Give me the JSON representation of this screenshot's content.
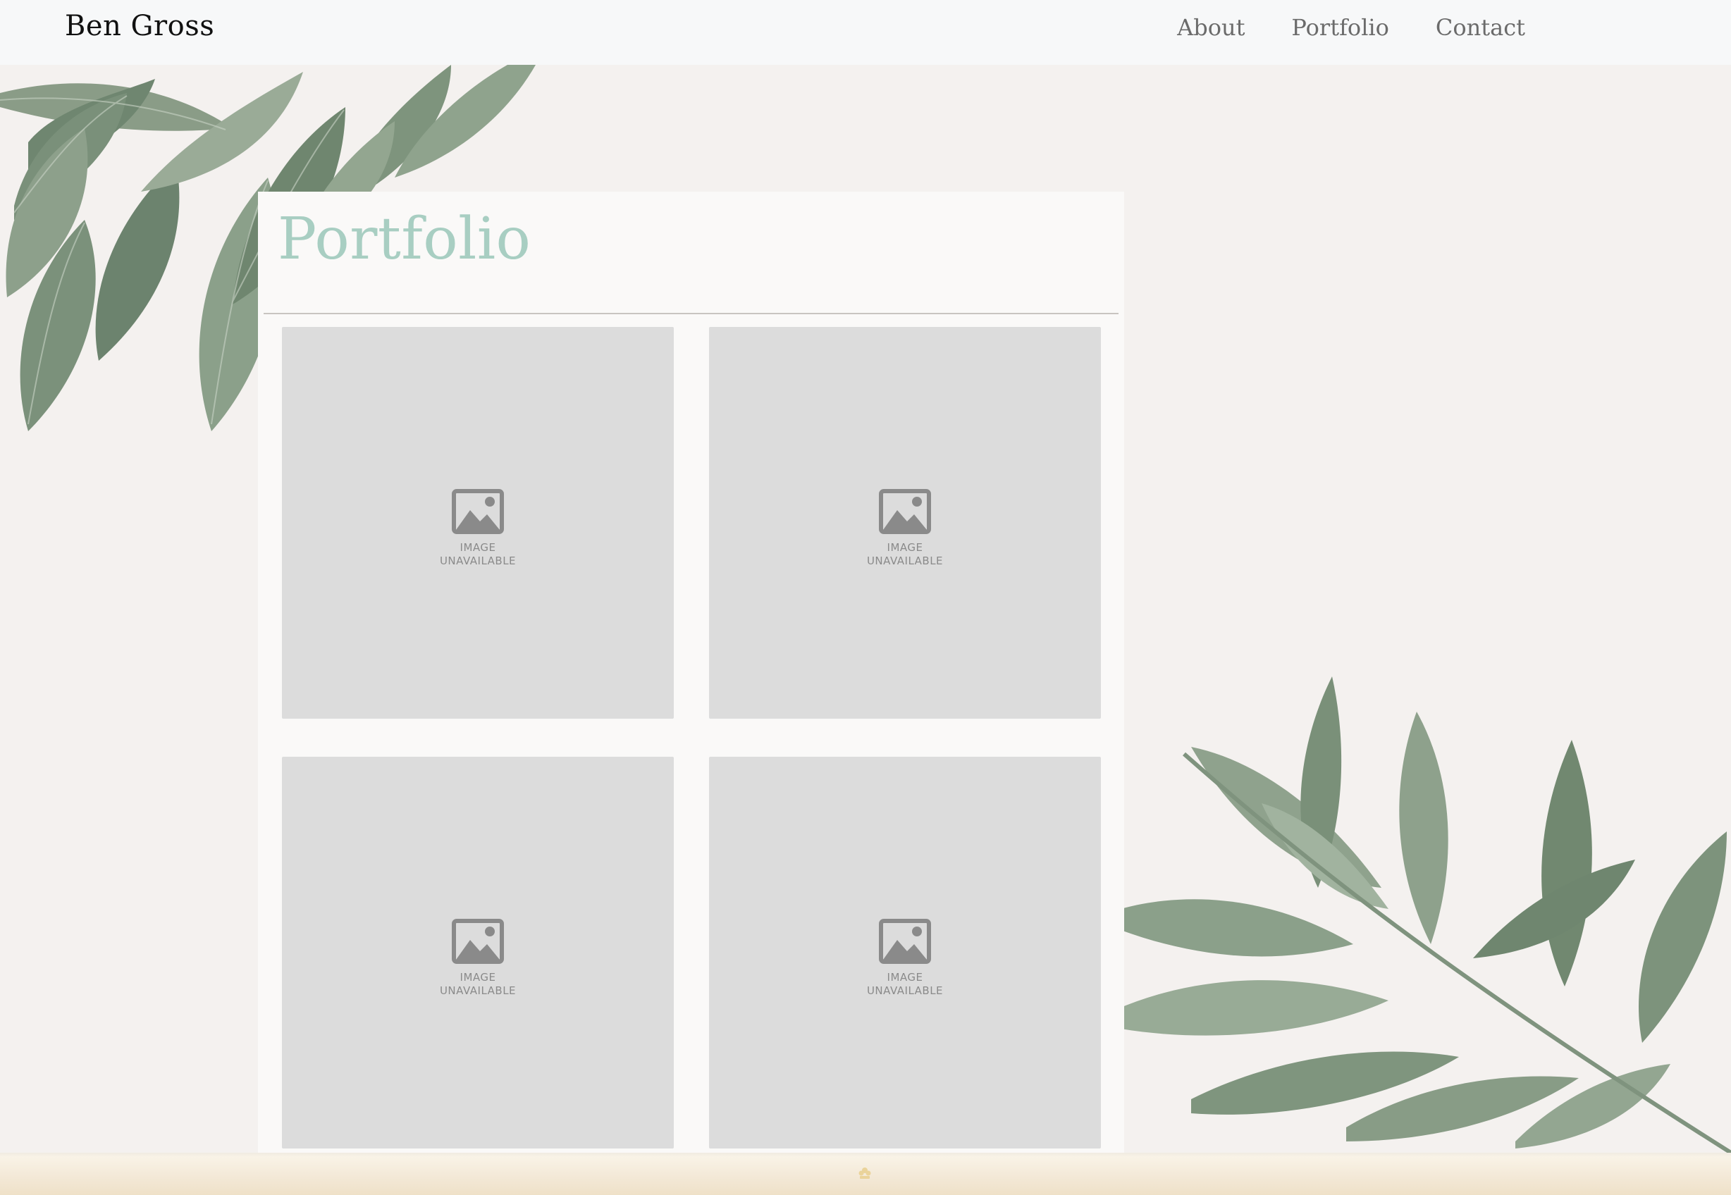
{
  "header": {
    "brand": "Ben Gross",
    "nav": [
      "About",
      "Portfolio",
      "Contact"
    ]
  },
  "main": {
    "title": "Portfolio",
    "tiles": [
      {
        "placeholder": "IMAGE\nUNAVAILABLE"
      },
      {
        "placeholder": "IMAGE\nUNAVAILABLE"
      },
      {
        "placeholder": "IMAGE\nUNAVAILABLE"
      },
      {
        "placeholder": "IMAGE\nUNAVAILABLE"
      }
    ]
  },
  "footer": {
    "icon": "flower-icon"
  },
  "colors": {
    "title_accent": "#a8cec2",
    "background": "#f4f1ef",
    "placeholder": "#dcdcdc",
    "leaf": "#7f947f"
  }
}
